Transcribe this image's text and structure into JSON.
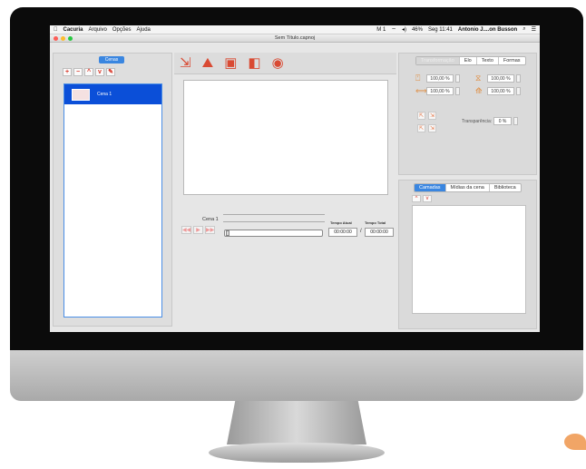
{
  "menubar": {
    "apple": "",
    "app_name": "Cacuria",
    "menus": [
      "Arquivo",
      "Opções",
      "Ajuda"
    ],
    "status_battery": "46%",
    "status_time": "Seg 11:41",
    "status_user": "Antonio J....on Busson",
    "status_m1": "M 1"
  },
  "window": {
    "title": "Sem Título.capnoj"
  },
  "left_panel": {
    "tab_label": "Cenas",
    "tools": [
      "+",
      "−",
      "^",
      "v",
      "✎"
    ],
    "scenes": [
      {
        "label": "Cena 1"
      }
    ]
  },
  "toolbar": {
    "icons": [
      "import-icon",
      "image-icon",
      "document-icon",
      "shapes-icon",
      "globe-icon"
    ],
    "glyphs": [
      "⇲",
      "⛰",
      "▣",
      "◧",
      "◉"
    ]
  },
  "timeline": {
    "scene_name": "Cena 1",
    "current_label": "Tempo Atual",
    "total_label": "Tempo Total",
    "current_time": "00:00:00",
    "total_time": "00:00:00",
    "separator": "/",
    "transport": [
      "◀◀",
      "▶",
      "▶▶"
    ],
    "progress": 0
  },
  "properties": {
    "tabs": [
      "Transformação",
      "Elo",
      "Texto",
      "Formas"
    ],
    "active_tab": 0,
    "fields": [
      "100,00 %",
      "100,00 %",
      "100,00 %",
      "100,00 %"
    ],
    "transparency_label": "Transparência:",
    "transparency_value": "0 %"
  },
  "layers": {
    "tabs": [
      "Camadas",
      "Mídias da cena",
      "Biblioteca"
    ],
    "active_tab": 0,
    "arrows": [
      "^",
      "v"
    ]
  },
  "colors": {
    "accent": "#3a86e0",
    "selection": "#0b4fd8",
    "icon": "#d94a33"
  }
}
